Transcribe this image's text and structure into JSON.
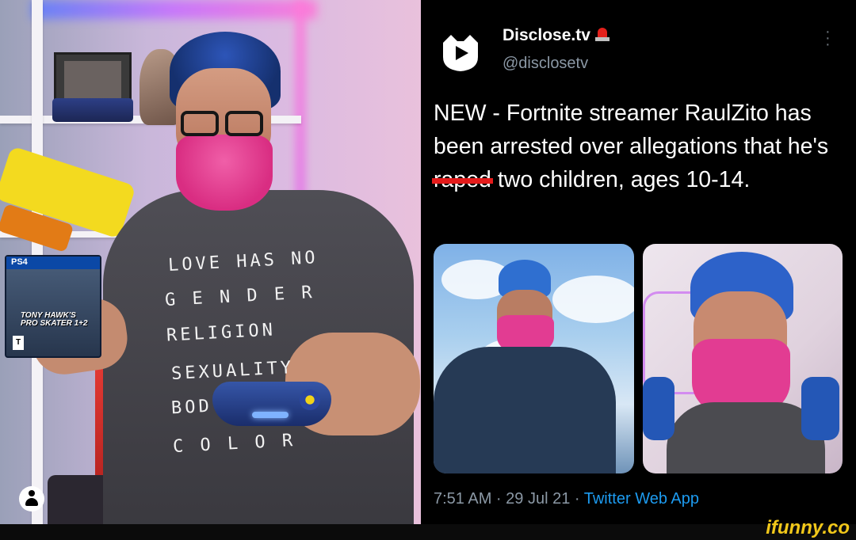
{
  "photo": {
    "shirt_lines": [
      "LOVE HAS NO",
      "G E N D E R",
      "RELIGION",
      "SEXUALITY",
      "BOD",
      "C O L O R"
    ],
    "game_box": {
      "platform": "PS4",
      "title_line1": "TONY HAWK'S",
      "title_line2": "PRO SKATER 1+2",
      "rating": "T"
    },
    "account_icon": "user-avatar-icon"
  },
  "tweet": {
    "display_name": "Disclose.tv",
    "badge_icon": "rotating-light-emoji",
    "handle": "@disclosetv",
    "menu_icon": "more-vertical-icon",
    "text_part1": "NEW - Fortnite streamer RaulZito has been arrested over allegations that he's ",
    "redacted_word": "raped",
    "text_part2": " two children, ages 10-14.",
    "timestamp": "7:51 AM · 29 Jul 21 · ",
    "source_app": "Twitter Web App",
    "images": [
      "photo-outdoor-portrait",
      "photo-gaming-portrait"
    ]
  },
  "watermark": {
    "text": "ifunny.co",
    "color": "#f2c81a"
  },
  "colors": {
    "link_blue": "#1d9bf0",
    "muted_gray": "#8b98a5",
    "redaction_red": "#e41b1b",
    "hair_blue": "#2d55b8",
    "beard_pink": "#e23c92"
  }
}
